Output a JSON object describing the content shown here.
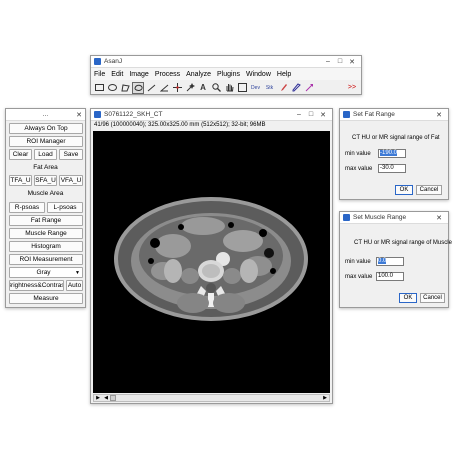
{
  "main_window": {
    "title": "AsanJ",
    "menus": [
      "File",
      "Edit",
      "Image",
      "Process",
      "Analyze",
      "Plugins",
      "Window",
      "Help"
    ],
    "tools": [
      "rectangle-tool",
      "oval-tool",
      "polygon-tool",
      "freehand-tool",
      "line-tool",
      "angle-tool",
      "point-tool",
      "wand-tool",
      "text-tool",
      "zoom-tool",
      "hand-tool",
      "dropper-tool"
    ],
    "dev_label": "Dev",
    "stk_label": "Stk",
    "more_label": ">>"
  },
  "panel": {
    "title": "...",
    "always_on_top": "Always On Top",
    "roi_manager": "ROI Manager",
    "clear": "Clear",
    "load": "Load",
    "save": "Save",
    "fat_area": "Fat Area",
    "tfa_u": "TFA_U",
    "sfa_u": "SFA_U",
    "vfa_u": "VFA_U",
    "muscle_area": "Muscle Area",
    "r_psoas": "R-psoas",
    "l_psoas": "L-psoas",
    "fat_range": "Fat Range",
    "muscle_range": "Muscle Range",
    "histogram": "Histogram",
    "roi_measurement": "ROI Measurement",
    "lut_value": "Gray",
    "brightness_contrast": "Brightness&Contrast",
    "auto": "Auto",
    "measure": "Measure"
  },
  "image_window": {
    "title": "S0761122_SKH_CT",
    "info": "41/96 (100000040); 325.00x325.00 mm (512x512); 32-bit; 96MB"
  },
  "fat_dialog": {
    "title": "Set Fat Range",
    "heading": "CT HU or MR signal range of Fat",
    "min_label": "min value",
    "min_value": "-190.0",
    "max_label": "max value",
    "max_value": "-30.0",
    "ok": "OK",
    "cancel": "Cancel"
  },
  "muscle_dialog": {
    "title": "Set Muscle Range",
    "heading": "CT HU or MR signal range of Muscle",
    "min_label": "min value",
    "min_value": "0.0",
    "max_label": "max value",
    "max_value": "100.0",
    "ok": "OK",
    "cancel": "Cancel"
  },
  "colors": {
    "selection": "#3d7ad6",
    "title_bg": "#ffffff",
    "window_bg": "#f0f0f0"
  }
}
